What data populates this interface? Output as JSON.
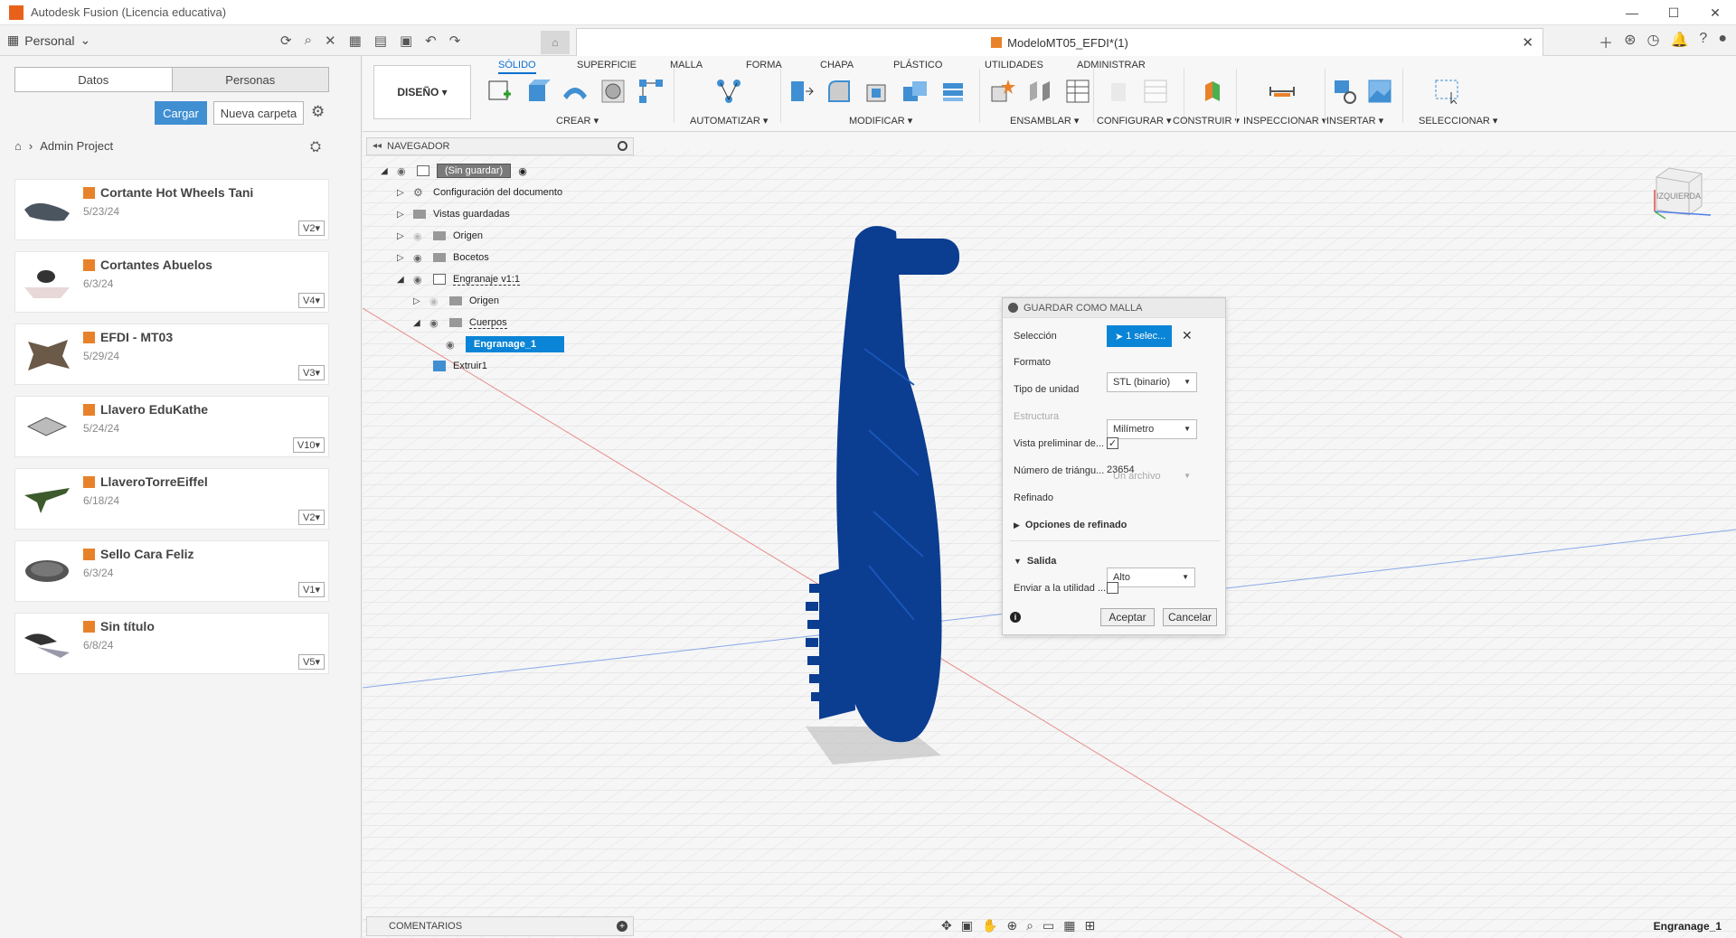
{
  "window": {
    "title": "Autodesk Fusion (Licencia educativa)"
  },
  "appbar": {
    "team": "Personal"
  },
  "document": {
    "tab_title": "ModeloMT05_EFDI*(1)"
  },
  "side": {
    "tab_data": "Datos",
    "tab_people": "Personas",
    "upload_btn": "Cargar",
    "new_folder_btn": "Nueva carpeta",
    "breadcrumb_project": "Admin Project",
    "files": [
      {
        "name": "Cortante Hot Wheels Tani",
        "date": "5/23/24",
        "version": "V2"
      },
      {
        "name": "Cortantes Abuelos",
        "date": "6/3/24",
        "version": "V4"
      },
      {
        "name": "EFDI - MT03",
        "date": "5/29/24",
        "version": "V3"
      },
      {
        "name": "Llavero EduKathe",
        "date": "5/24/24",
        "version": "V10"
      },
      {
        "name": "LlaveroTorreEiffel",
        "date": "6/18/24",
        "version": "V2"
      },
      {
        "name": "Sello Cara Feliz",
        "date": "6/3/24",
        "version": "V1"
      },
      {
        "name": "Sin título",
        "date": "6/8/24",
        "version": "V5"
      }
    ]
  },
  "toolbar": {
    "workspace": "DISEÑO",
    "tabs": [
      "SÓLIDO",
      "SUPERFICIE",
      "MALLA",
      "FORMA",
      "CHAPA",
      "PLÁSTICO",
      "UTILIDADES",
      "ADMINISTRAR"
    ],
    "groups": [
      "CREAR",
      "AUTOMATIZAR",
      "MODIFICAR",
      "ENSAMBLAR",
      "CONFIGURAR",
      "CONSTRUIR",
      "INSPECCIONAR",
      "INSERTAR",
      "SELECCIONAR"
    ]
  },
  "navigator": {
    "title": "NAVEGADOR",
    "root": "(Sin guardar)",
    "items": [
      "Configuración del documento",
      "Vistas guardadas",
      "Origen",
      "Bocetos",
      "Engranaje v1:1",
      "Origen",
      "Cuerpos",
      "Engranage_1",
      "Extruir1"
    ]
  },
  "dialog": {
    "title": "GUARDAR COMO MALLA",
    "labels": {
      "selection": "Selección",
      "format": "Formato",
      "unit": "Tipo de unidad",
      "structure": "Estructura",
      "preview": "Vista preliminar de...",
      "triangles": "Número de triángu...",
      "refinement": "Refinado",
      "refine_options": "Opciones de refinado",
      "output": "Salida",
      "send_to": "Enviar a la utilidad ..."
    },
    "values": {
      "selection": "1 selec...",
      "format": "STL (binario)",
      "unit": "Milímetro",
      "structure": "Un archivo",
      "triangles": "23654",
      "refinement": "Alto"
    },
    "ok": "Aceptar",
    "cancel": "Cancelar"
  },
  "viewcube": {
    "face": "IZQUIERDA"
  },
  "bottom": {
    "comments": "COMENTARIOS",
    "status": "Engranage_1"
  },
  "colors": {
    "accent": "#0a84d6",
    "model": "#0b3d91"
  }
}
